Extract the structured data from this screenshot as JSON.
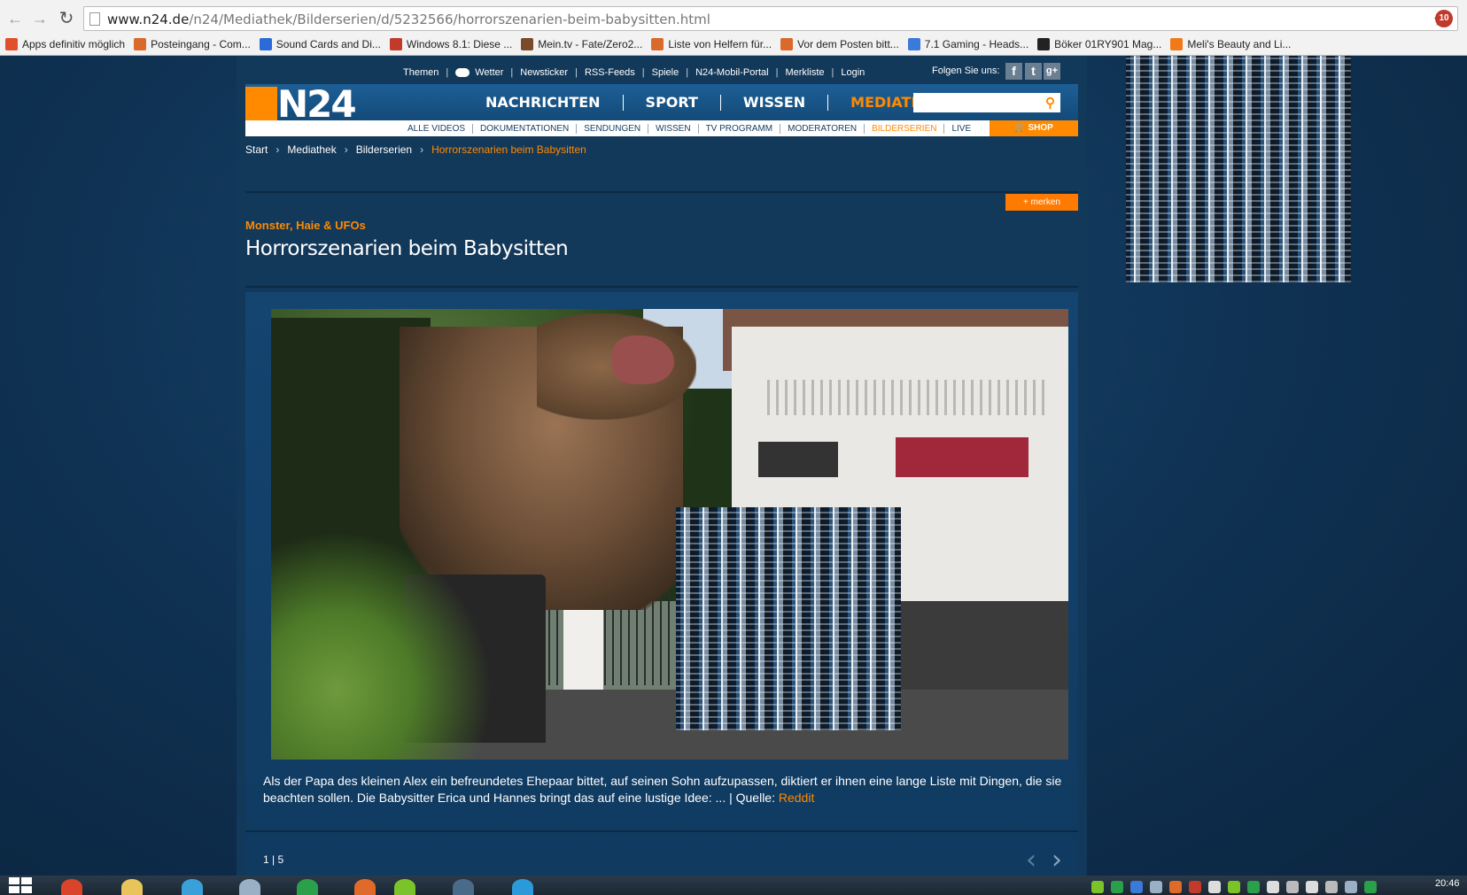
{
  "browser": {
    "url_domain": "www.n24.de",
    "url_path": "/n24/Mediathek/Bilderserien/d/5232566/horrorszenarien-beim-babysitten.html",
    "extension_badge": "10",
    "bookmarks": [
      {
        "label": "Apps definitiv möglich",
        "color": "#e0502a"
      },
      {
        "label": "Posteingang - Com...",
        "color": "#d96a2b"
      },
      {
        "label": "Sound Cards and Di...",
        "color": "#2a6bd9"
      },
      {
        "label": "Windows 8.1: Diese ...",
        "color": "#c23a2a"
      },
      {
        "label": "Mein.tv - Fate/Zero2...",
        "color": "#7a4a2a"
      },
      {
        "label": "Liste von Helfern für...",
        "color": "#d96a2b"
      },
      {
        "label": "Vor dem Posten bitt...",
        "color": "#d96a2b"
      },
      {
        "label": "7.1 Gaming - Heads...",
        "color": "#3a7ad9"
      },
      {
        "label": "Böker 01RY901 Mag...",
        "color": "#222222"
      },
      {
        "label": "Meli's Beauty and Li...",
        "color": "#f07a1a"
      }
    ]
  },
  "topbar": {
    "items": [
      "Themen",
      "Wetter",
      "Newsticker",
      "RSS-Feeds",
      "Spiele",
      "N24-Mobil-Portal",
      "Merkliste",
      "Login"
    ],
    "follow_label": "Folgen Sie uns:",
    "social": [
      "f",
      "t",
      "g+"
    ]
  },
  "header": {
    "logo": "N24",
    "main_nav": [
      "NACHRICHTEN",
      "SPORT",
      "WISSEN",
      "MEDIATHEK"
    ],
    "active_main": "MEDIATHEK",
    "sub_nav": [
      "ALLE VIDEOS",
      "DOKUMENTATIONEN",
      "SENDUNGEN",
      "WISSEN",
      "TV PROGRAMM",
      "MODERATOREN",
      "BILDERSERIEN",
      "LIVE"
    ],
    "active_sub": "BILDERSERIEN",
    "shop_label": "SHOP"
  },
  "breadcrumb": {
    "items": [
      "Start",
      "Mediathek",
      "Bilderserien"
    ],
    "current": "Horrorszenarien beim Babysitten"
  },
  "article": {
    "merken_label": "+ merken",
    "kicker": "Monster, Haie & UFOs",
    "title": "Horrorszenarien beim Babysitten",
    "caption": "Als der Papa des kleinen Alex ein befreundetes Ehepaar bittet, auf seinen Sohn aufzupassen, diktiert er ihnen eine lange Liste mit Dingen, die sie beachten sollen. Die Babysitter Erica und Hannes bringt das auf eine lustige Idee: ... | Quelle: ",
    "source_label": "Reddit",
    "pager": "1 | 5"
  },
  "taskbar": {
    "clock": "20:46",
    "items": [
      {
        "name": "chrome",
        "color": "#d9442a"
      },
      {
        "name": "explorer",
        "color": "#e8c45a"
      },
      {
        "name": "network",
        "color": "#3aa0d9"
      },
      {
        "name": "monitor",
        "color": "#9ab0c4"
      },
      {
        "name": "store",
        "color": "#2aa04a"
      },
      {
        "name": "app",
        "color": "#e06a2a"
      },
      {
        "name": "spotify",
        "color": "#7ac42a"
      },
      {
        "name": "steam",
        "color": "#4a6a8a"
      },
      {
        "name": "skype",
        "color": "#2a9ad9"
      }
    ]
  },
  "colors": {
    "accent": "#ff8a00",
    "background": "#0e2f4f"
  }
}
